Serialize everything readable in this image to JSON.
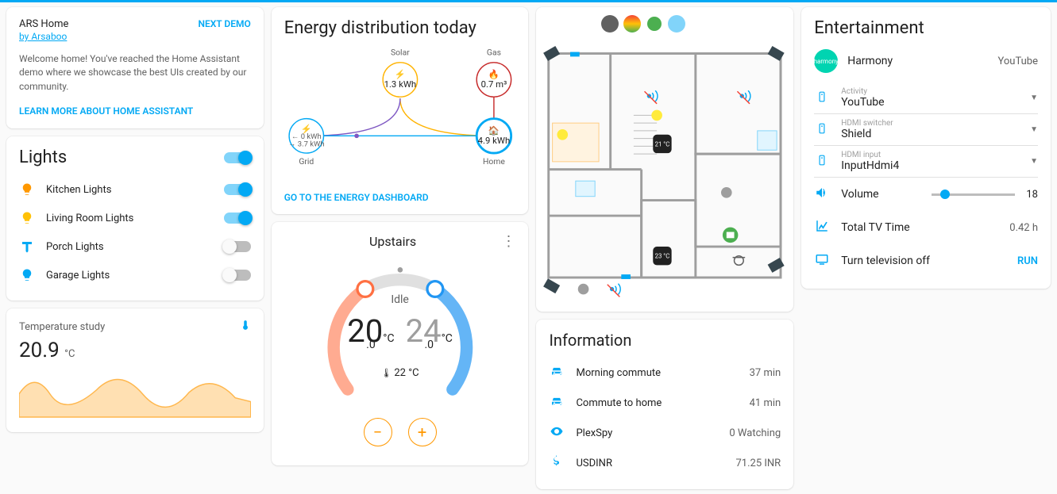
{
  "welcome": {
    "title": "ARS Home",
    "by": "by Arsaboo",
    "next_demo": "NEXT DEMO",
    "desc": "Welcome home! You've reached the Home Assistant demo where we showcase the best UIs created by our community.",
    "learn_more": "LEARN MORE ABOUT HOME ASSISTANT"
  },
  "lights": {
    "title": "Lights",
    "items": [
      {
        "label": "Kitchen Lights",
        "on": true,
        "iconColor": "#ff9800"
      },
      {
        "label": "Living Room Lights",
        "on": true,
        "iconColor": "#ffc107"
      },
      {
        "label": "Porch Lights",
        "on": false,
        "iconColor": "#03a9f4"
      },
      {
        "label": "Garage Lights",
        "on": false,
        "iconColor": "#03a9f4"
      }
    ]
  },
  "temperature": {
    "label": "Temperature study",
    "value": "20.9",
    "unit": "°C"
  },
  "energy": {
    "title": "Energy distribution today",
    "solar": {
      "label": "Solar",
      "value": "1.3 kWh"
    },
    "gas": {
      "label": "Gas",
      "value": "0.7 m³"
    },
    "grid": {
      "label": "Grid",
      "in": "← 0 kWh",
      "out": "→ 3.7 kWh"
    },
    "home": {
      "label": "Home",
      "value": "4.9 kWh"
    },
    "link": "GO TO THE ENERGY DASHBOARD"
  },
  "thermostat": {
    "name": "Upstairs",
    "status": "Idle",
    "low": "20",
    "low_dec": ".0",
    "low_unit": "°C",
    "high": "24",
    "high_dec": ".0",
    "high_unit": "°C",
    "current": "22 °C"
  },
  "floorplan": {
    "temp1": "21 °C",
    "temp2": "23 °C"
  },
  "information": {
    "title": "Information",
    "items": [
      {
        "icon": "car",
        "label": "Morning commute",
        "value": "37 min"
      },
      {
        "icon": "car",
        "label": "Commute to home",
        "value": "41 min"
      },
      {
        "icon": "eye",
        "label": "PlexSpy",
        "value": "0 Watching"
      },
      {
        "icon": "dollar",
        "label": "USDINR",
        "value": "71.25 INR"
      }
    ]
  },
  "entertainment": {
    "title": "Entertainment",
    "harmony": {
      "name": "Harmony",
      "state": "YouTube"
    },
    "selects": [
      {
        "label": "Activity",
        "value": "YouTube"
      },
      {
        "label": "HDMI switcher",
        "value": "Shield"
      },
      {
        "label": "HDMI input",
        "value": "InputHdmi4"
      }
    ],
    "volume": {
      "label": "Volume",
      "value": "18"
    },
    "tvtime": {
      "label": "Total TV Time",
      "value": "0.42 h"
    },
    "tvoff": {
      "label": "Turn television off",
      "action": "RUN"
    }
  }
}
